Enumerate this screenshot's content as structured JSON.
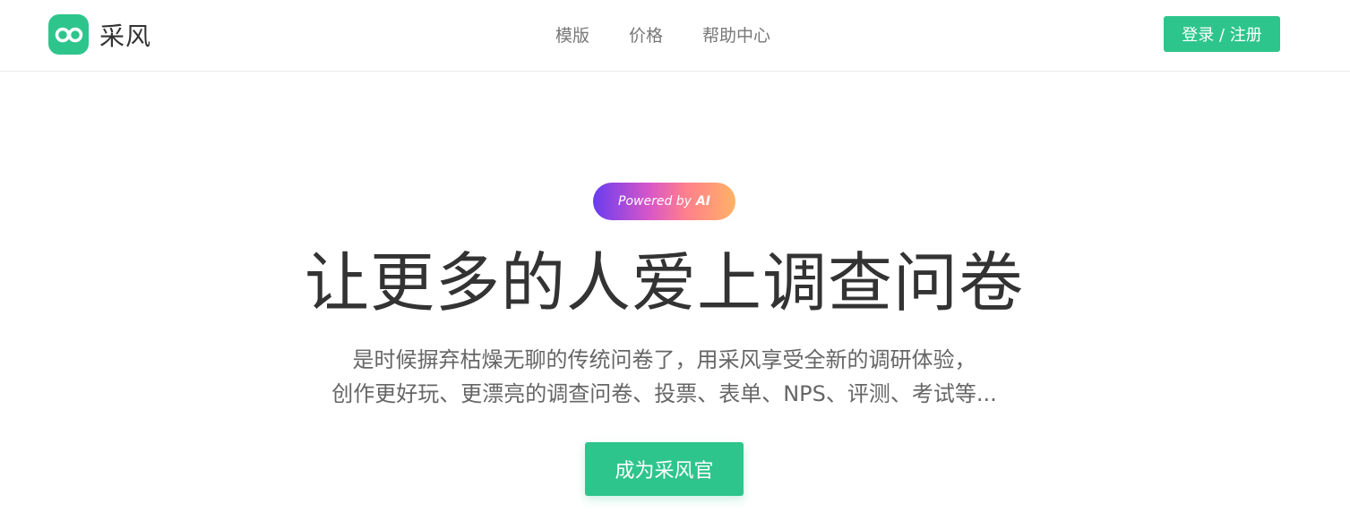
{
  "header": {
    "brand": "采风",
    "logo_icon": "infinity-icon",
    "nav": [
      {
        "label": "模版"
      },
      {
        "label": "价格"
      },
      {
        "label": "帮助中心"
      }
    ],
    "login_label": "登录 / 注册"
  },
  "hero": {
    "badge_prefix": "Powered by",
    "badge_ai": "AI",
    "title": "让更多的人爱上调查问卷",
    "subtitle_line1": "是时候摒弃枯燥无聊的传统问卷了，用采风享受全新的调研体验，",
    "subtitle_line2": "创作更好玩、更漂亮的调查问卷、投票、表单、NPS、评测、考试等...",
    "cta_label": "成为采风官"
  },
  "colors": {
    "brand_green": "#2ec58c",
    "text_dark": "#333333",
    "text_gray": "#777777"
  }
}
